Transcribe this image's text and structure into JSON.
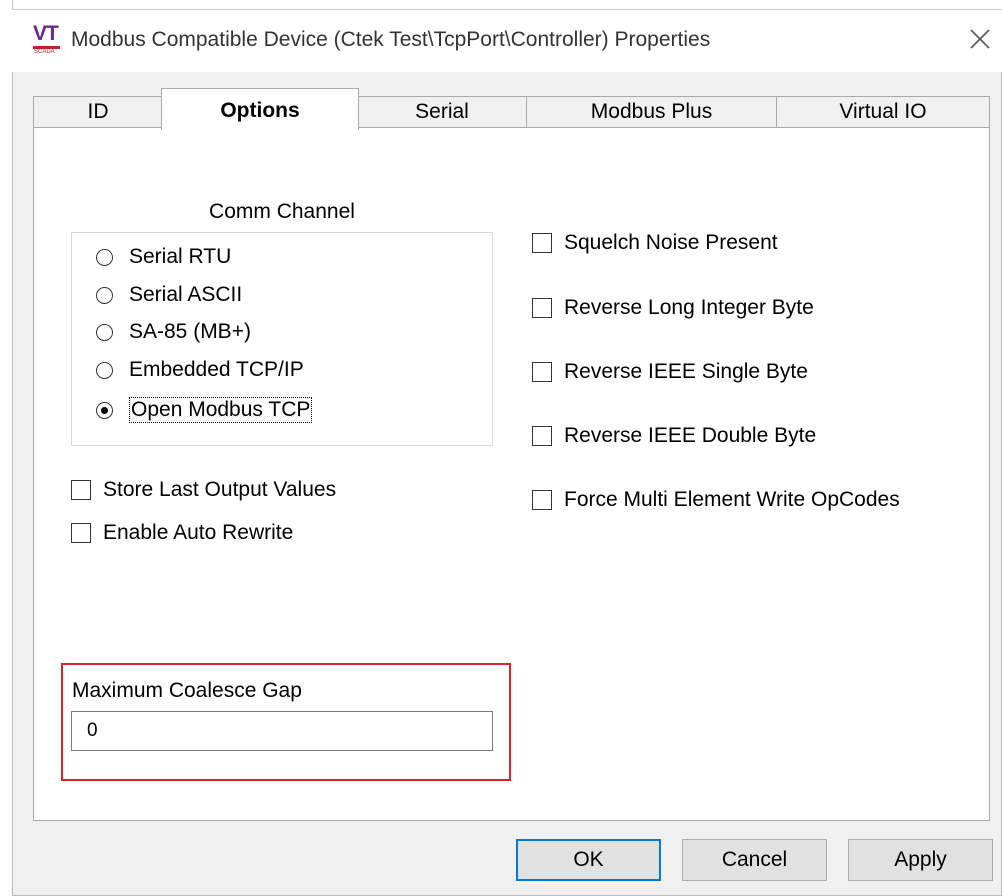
{
  "window": {
    "title": "Modbus Compatible Device (Ctek Test\\TcpPort\\Controller) Properties",
    "logo_letters": "VT",
    "logo_sub": "SCADA"
  },
  "tabs": [
    {
      "label": "ID",
      "selected": false
    },
    {
      "label": "Options",
      "selected": true
    },
    {
      "label": "Serial",
      "selected": false
    },
    {
      "label": "Modbus Plus",
      "selected": false
    },
    {
      "label": "Virtual IO",
      "selected": false
    }
  ],
  "comm_channel": {
    "legend": "Comm Channel",
    "selected": "Open Modbus TCP",
    "options": [
      "Serial RTU",
      "Serial ASCII",
      "SA-85 (MB+)",
      "Embedded TCP/IP",
      "Open Modbus TCP"
    ]
  },
  "left_checks": [
    {
      "label": "Store Last Output Values",
      "checked": false
    },
    {
      "label": "Enable Auto Rewrite",
      "checked": false
    }
  ],
  "right_checks": [
    {
      "label": "Squelch Noise Present",
      "checked": false
    },
    {
      "label": "Reverse Long Integer Byte",
      "checked": false
    },
    {
      "label": "Reverse IEEE Single Byte",
      "checked": false
    },
    {
      "label": "Reverse IEEE Double Byte",
      "checked": false
    },
    {
      "label": "Force Multi Element Write OpCodes",
      "checked": false
    }
  ],
  "coalesce": {
    "label": "Maximum Coalesce Gap",
    "value": "0"
  },
  "buttons": {
    "ok": "OK",
    "cancel": "Cancel",
    "apply": "Apply"
  },
  "colors": {
    "highlight_border": "#d9232e",
    "default_button_border": "#0078d7",
    "logo_purple": "#6a2a8f",
    "logo_red": "#c22127"
  },
  "icons": {
    "close": "close-icon",
    "logo": "vtscada-logo-icon"
  }
}
